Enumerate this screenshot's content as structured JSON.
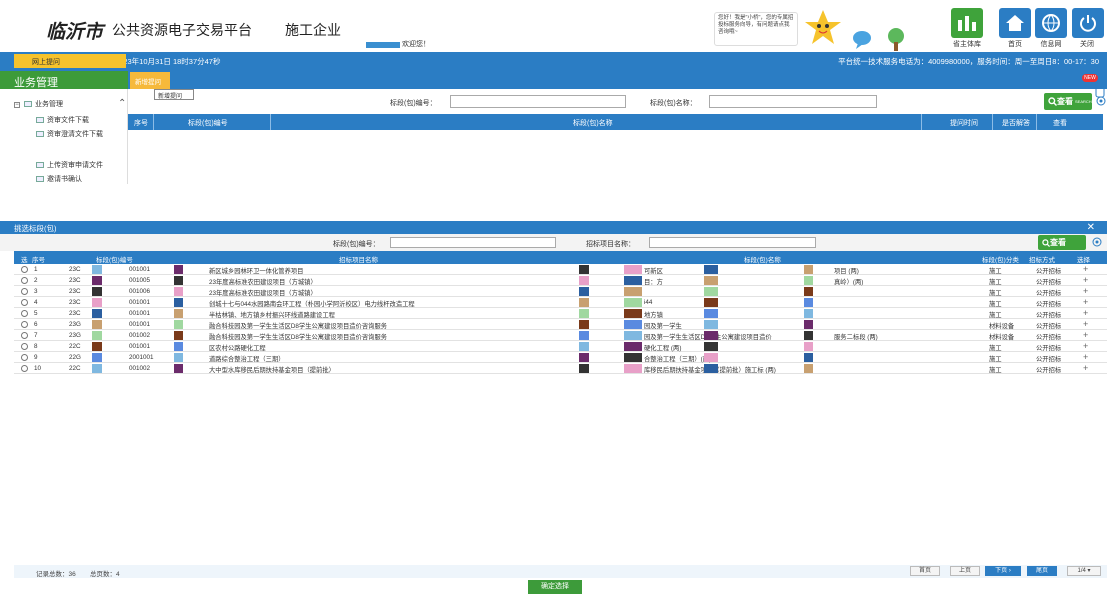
{
  "header": {
    "city": "临沂市",
    "platform": "公共资源电子交易平台",
    "role": "施工企业",
    "welcome": "欢迎您！",
    "bubble_text": "您好！我是\"小桥\"，您的专属招投标服务向导，有问题请点我咨询哦~",
    "toolbar": [
      {
        "label": "省主体库",
        "icon": "province-library-icon",
        "color": "#3fa33b"
      },
      {
        "label": "首页",
        "icon": "home-icon",
        "color": "#2b7dc4"
      },
      {
        "label": "信息网",
        "icon": "globe-icon",
        "color": "#2b7dc4"
      },
      {
        "label": "关闭",
        "icon": "power-icon",
        "color": "#2b7dc4"
      }
    ]
  },
  "topbar": {
    "datetime": "2023年10月31日 18时37分47秒",
    "hotline": "平台统一技术服务电话为：4009980000，服务时间：周一至周日8：00-17：30"
  },
  "left": {
    "title": "业务管理",
    "root": "业务管理",
    "items": [
      "资审文件下载",
      "资审澄清文件下载",
      "网上提问",
      "上传资审申请文件",
      "邀请书确认"
    ],
    "active_index": 2
  },
  "tabs": {
    "new_tab": "新增提问",
    "tooltip": "新增提问",
    "new_badge": "NEW"
  },
  "search1": {
    "code_label": "标段(包)编号：",
    "name_label": "标段(包)名称：",
    "button": "查看",
    "button_sub": "SEARCH"
  },
  "grid1": {
    "columns": [
      "序号",
      "标段(包)编号",
      "标段(包)名称",
      "提问时间",
      "是否解答",
      "查看"
    ]
  },
  "dialog": {
    "title": "挑选标段(包)",
    "code_label": "标段(包)编号：",
    "project_label": "招标项目名称：",
    "button": "查看",
    "columns": [
      "选",
      "序号",
      "标段(包)编号",
      "招标项目名称",
      "标段(包)名称",
      "标段(包)分类",
      "招标方式",
      "选择"
    ],
    "rows": [
      {
        "no": "1",
        "code_a": "23C",
        "code_b": "001001",
        "project": "新区城乡园林环卫一体化管养项目",
        "section": "可新区",
        "section2": "项目 (两)",
        "cat": "施工",
        "method": "公开招标"
      },
      {
        "no": "2",
        "code_a": "23C",
        "code_b": "001005",
        "project": "23年度高标准农田建设项目（方城镇）",
        "section": "目：方",
        "section2": "真岭）(两)",
        "cat": "施工",
        "method": "公开招标"
      },
      {
        "no": "3",
        "code_a": "23C",
        "code_b": "001006",
        "project": "23年度高标准农田建设项目（方城镇）",
        "section": "",
        "section2": "",
        "cat": "施工",
        "method": "公开招标"
      },
      {
        "no": "4",
        "code_a": "23C",
        "code_b": "001001",
        "project": "创城十七与044水园路南会环工程（朴园小学阿沂校区）电力线杆改造工程",
        "section": "i44",
        "section2": "",
        "cat": "施工",
        "method": "公开招标"
      },
      {
        "no": "5",
        "code_a": "23C",
        "code_b": "001001",
        "project": "半枯林镇、地方镇乡村振兴环线道路建设工程",
        "section": "地方镇",
        "section2": "",
        "cat": "施工",
        "method": "公开招标"
      },
      {
        "no": "6",
        "code_a": "23G",
        "code_b": "001001",
        "project": "融合科技园及第一学生生活区D8学生公寓建设项目造价咨询服务",
        "section": "园及第一学生",
        "section2": "",
        "cat": "材料设备",
        "method": "公开招标"
      },
      {
        "no": "7",
        "code_a": "23G",
        "code_b": "001002",
        "project": "融合科技园及第一学生生活区D8学生公寓建设项目造价咨询服务",
        "section": "园及第一学生生活区D8学生公寓建设项目造价",
        "section2": "服务二标段 (两)",
        "cat": "材料设备",
        "method": "公开招标"
      },
      {
        "no": "8",
        "code_a": "22C",
        "code_b": "001001",
        "project": "区农村公路硬化工程",
        "section": "硬化工程 (两)",
        "section2": "",
        "cat": "施工",
        "method": "公开招标"
      },
      {
        "no": "9",
        "code_a": "22G",
        "code_b": "2001001",
        "project": "道路综合整治工程（三期）",
        "section": "合整治工程（三期）(两)",
        "section2": "",
        "cat": "施工",
        "method": "公开招标"
      },
      {
        "no": "10",
        "code_a": "22C",
        "code_b": "001002",
        "project": "大中型水库移民后期扶持基金项目（提前批）",
        "section": "库移民后期扶持基金项目（提前批）施工标 (两)",
        "section2": "",
        "cat": "施工",
        "method": "公开招标"
      }
    ],
    "footer": {
      "records": "记录总数：36",
      "pages": "总页数：4",
      "first": "首页",
      "prev": "上页",
      "next": "下页",
      "last": "尾页",
      "page_indicator": "1/4"
    },
    "confirm": "确定选择"
  }
}
